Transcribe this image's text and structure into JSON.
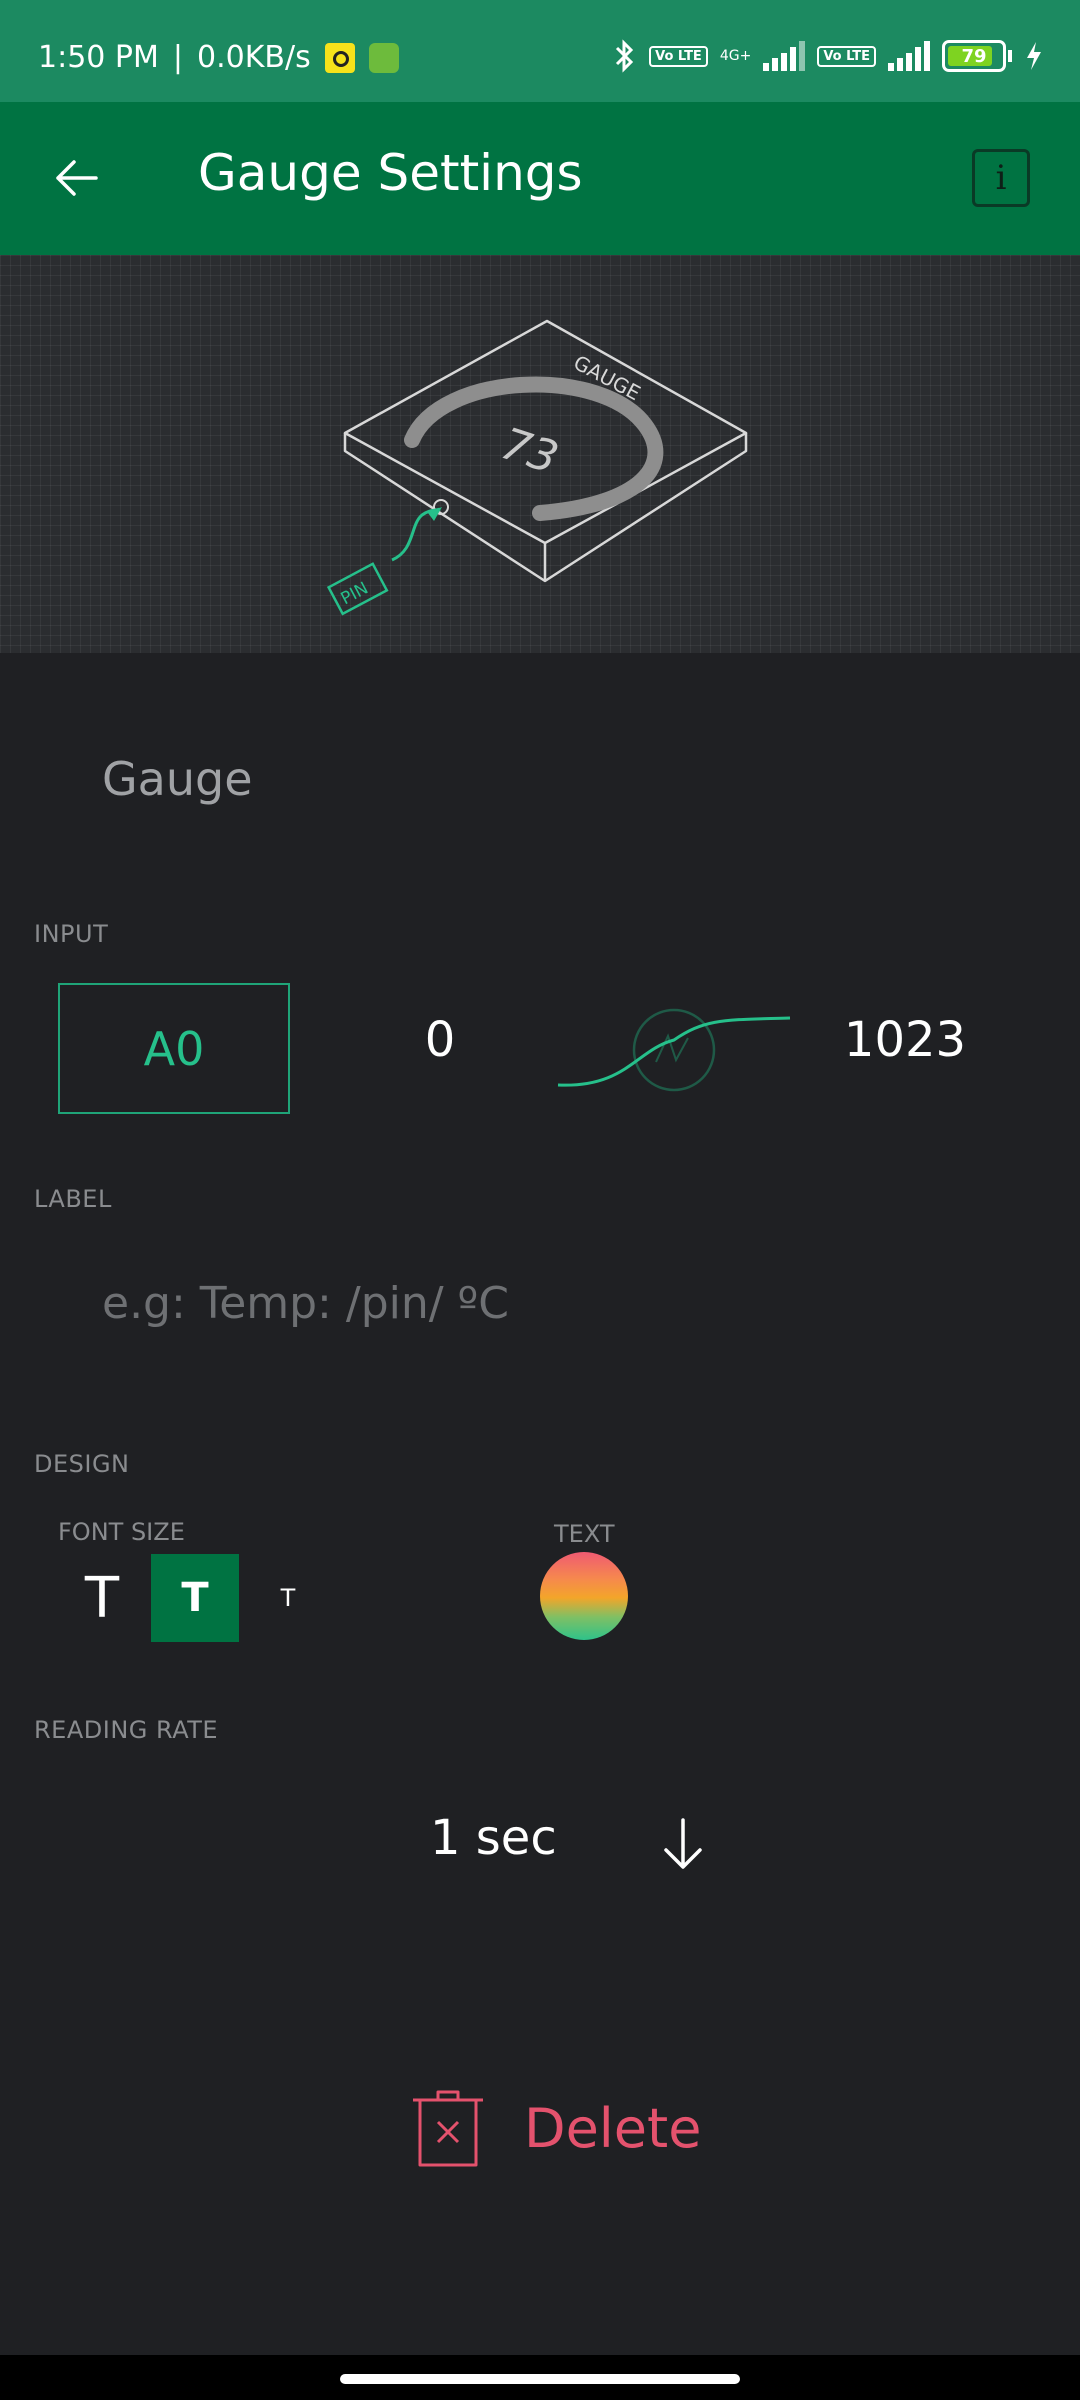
{
  "status_bar": {
    "time": "1:50 PM",
    "separator": "|",
    "speed": "0.0KB/s",
    "network_label": "4G+",
    "volte_label": "Vo LTE",
    "battery_level": "79",
    "icons": [
      "bluetooth-icon",
      "signal-icon",
      "battery-icon",
      "charging-icon"
    ]
  },
  "app_bar": {
    "title": "Gauge Settings",
    "info_label": "i"
  },
  "preview": {
    "widget_label": "GAUGE",
    "gauge_value": "73",
    "pin_label": "PIN"
  },
  "form": {
    "widget_name": "Gauge",
    "input": {
      "section_label": "INPUT",
      "pin": "A0",
      "min": "0",
      "max": "1023"
    },
    "label": {
      "section_label": "LABEL",
      "placeholder": "e.g: Temp: /pin/ ºC"
    },
    "design": {
      "section_label": "DESIGN",
      "font_size_label": "FONT SIZE",
      "font_sizes": [
        "T",
        "T",
        "T"
      ],
      "selected_font_size": "medium",
      "text_color_label": "TEXT"
    },
    "reading_rate": {
      "section_label": "READING RATE",
      "value": "1 sec"
    },
    "delete_label": "Delete"
  },
  "colors": {
    "status_bar": "#1c8a61",
    "app_bar": "#007342",
    "background": "#1f2023",
    "accent": "#26c08b",
    "danger": "#e4526d"
  }
}
